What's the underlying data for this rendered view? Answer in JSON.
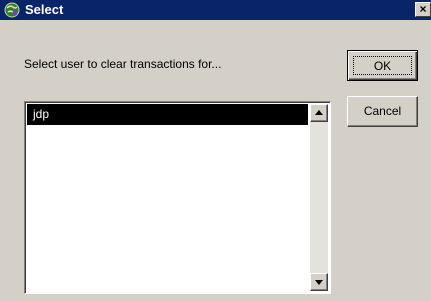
{
  "window": {
    "title": "Select",
    "close_glyph": "×",
    "title_icon": "globe-icon",
    "titlebar_color": "#0a246a"
  },
  "prompt": "Select user to clear transactions for...",
  "buttons": {
    "ok_label": "OK",
    "cancel_label": "Cancel"
  },
  "list": {
    "items": [
      "jdp"
    ],
    "selected_index": 0
  }
}
